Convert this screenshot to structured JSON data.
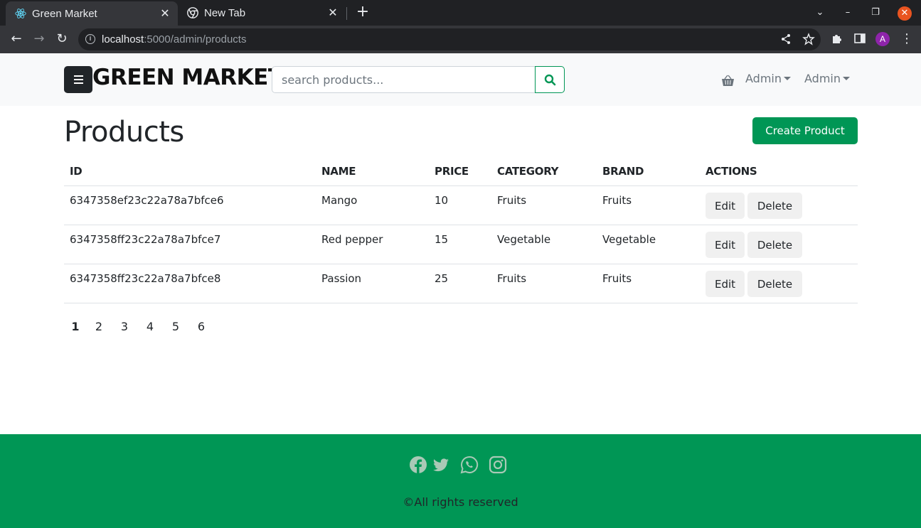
{
  "browser": {
    "tabs": [
      {
        "title": "Green Market",
        "active": true
      },
      {
        "title": "New Tab",
        "active": false
      }
    ],
    "url_host": "localhost",
    "url_path": ":5000/admin/products",
    "avatar_letter": "A"
  },
  "header": {
    "brand": "GREEN MARKET",
    "search_placeholder": "search products...",
    "dropdowns": [
      "Admin",
      "Admin"
    ]
  },
  "page": {
    "title": "Products",
    "create_button": "Create Product"
  },
  "table": {
    "columns": [
      "ID",
      "NAME",
      "PRICE",
      "CATEGORY",
      "BRAND",
      "ACTIONS"
    ],
    "rows": [
      {
        "id": "6347358ef23c22a78a7bfce6",
        "name": "Mango",
        "price": "10",
        "category": "Fruits",
        "brand": "Fruits"
      },
      {
        "id": "6347358ff23c22a78a7bfce7",
        "name": "Red pepper",
        "price": "15",
        "category": "Vegetable",
        "brand": "Vegetable"
      },
      {
        "id": "6347358ff23c22a78a7bfce8",
        "name": "Passion",
        "price": "25",
        "category": "Fruits",
        "brand": "Fruits"
      }
    ],
    "edit_label": "Edit",
    "delete_label": "Delete"
  },
  "pagination": {
    "pages": [
      "1",
      "2",
      "3",
      "4",
      "5",
      "6"
    ],
    "current": "1"
  },
  "footer": {
    "social_icons": [
      "facebook-icon",
      "twitter-icon",
      "whatsapp-icon",
      "instagram-icon"
    ],
    "copyright": "©All rights reserved"
  },
  "colors": {
    "brand_green": "#009655",
    "header_bg": "#f8f9fa",
    "dark": "#212529",
    "chrome_dark": "#202124",
    "chrome_mid": "#35363a"
  }
}
